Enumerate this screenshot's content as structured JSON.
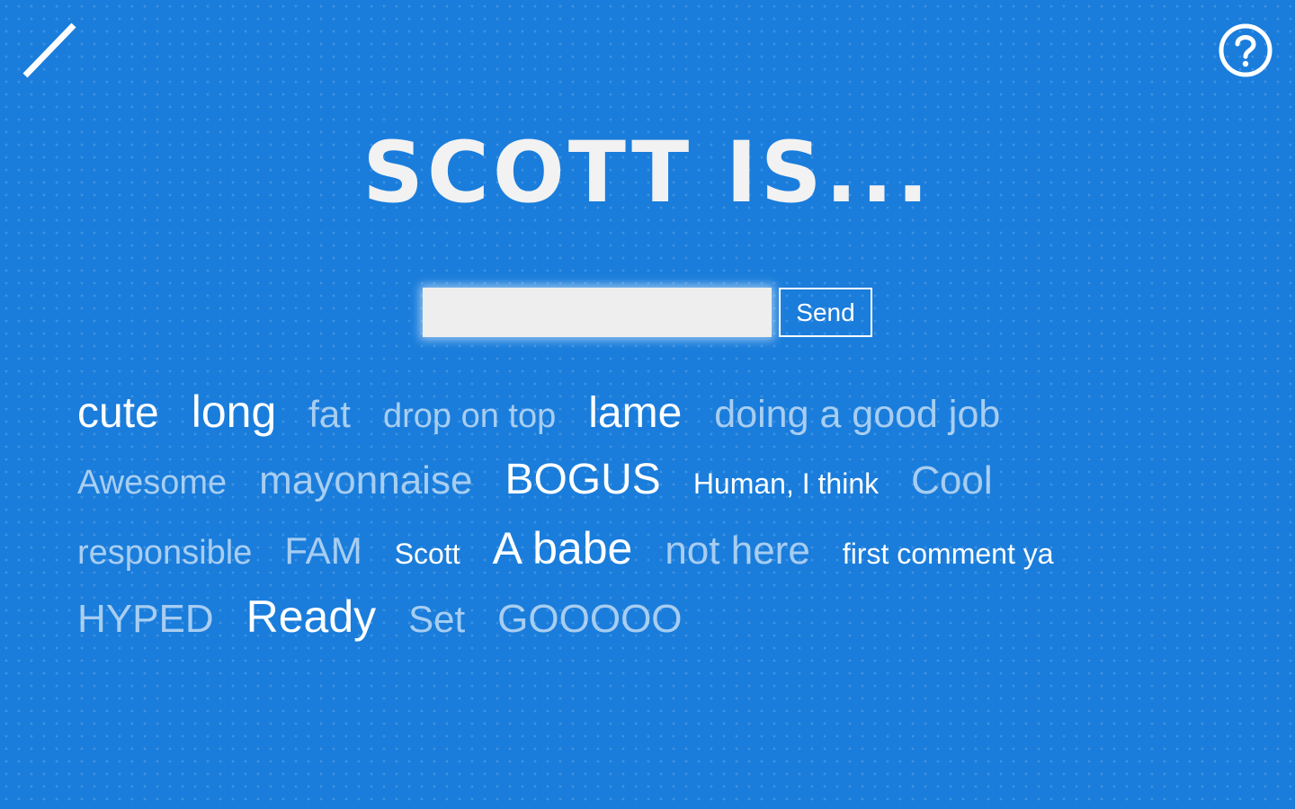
{
  "header": {
    "logo_icon": "slash-logo-icon",
    "help_icon": "help-circle-icon"
  },
  "title": "SCOTT IS...",
  "form": {
    "input_value": "",
    "input_placeholder": "",
    "send_label": "Send"
  },
  "words": {
    "rows": [
      [
        {
          "text": "cute",
          "size": 48,
          "opacity": 1.0
        },
        {
          "text": "long",
          "size": 50,
          "opacity": 1.0
        },
        {
          "text": "fat",
          "size": 42,
          "opacity": 0.62
        },
        {
          "text": "drop on top",
          "size": 38,
          "opacity": 0.62
        },
        {
          "text": "lame",
          "size": 48,
          "opacity": 1.0
        },
        {
          "text": "doing a good job",
          "size": 43,
          "opacity": 0.62
        }
      ],
      [
        {
          "text": "Awesome",
          "size": 38,
          "opacity": 0.62
        },
        {
          "text": "mayonnaise",
          "size": 44,
          "opacity": 0.62
        },
        {
          "text": "BOGUS",
          "size": 48,
          "opacity": 1.0
        },
        {
          "text": "Human, I think",
          "size": 32,
          "opacity": 1.0
        },
        {
          "text": "Cool",
          "size": 44,
          "opacity": 0.62
        }
      ],
      [
        {
          "text": "responsible",
          "size": 38,
          "opacity": 0.62
        },
        {
          "text": "FAM",
          "size": 42,
          "opacity": 0.62
        },
        {
          "text": "Scott",
          "size": 32,
          "opacity": 1.0
        },
        {
          "text": "A babe",
          "size": 50,
          "opacity": 1.0
        },
        {
          "text": "not here",
          "size": 44,
          "opacity": 0.62
        },
        {
          "text": "first comment ya",
          "size": 32,
          "opacity": 1.0
        }
      ],
      [
        {
          "text": "HYPED",
          "size": 44,
          "opacity": 0.62
        },
        {
          "text": "Ready",
          "size": 50,
          "opacity": 1.0
        },
        {
          "text": "Set",
          "size": 42,
          "opacity": 0.62
        },
        {
          "text": "GOOOOO",
          "size": 44,
          "opacity": 0.62
        }
      ]
    ]
  },
  "colors": {
    "background": "#1a7ddb",
    "text": "#ffffff",
    "input_bg": "#eeeeee"
  }
}
